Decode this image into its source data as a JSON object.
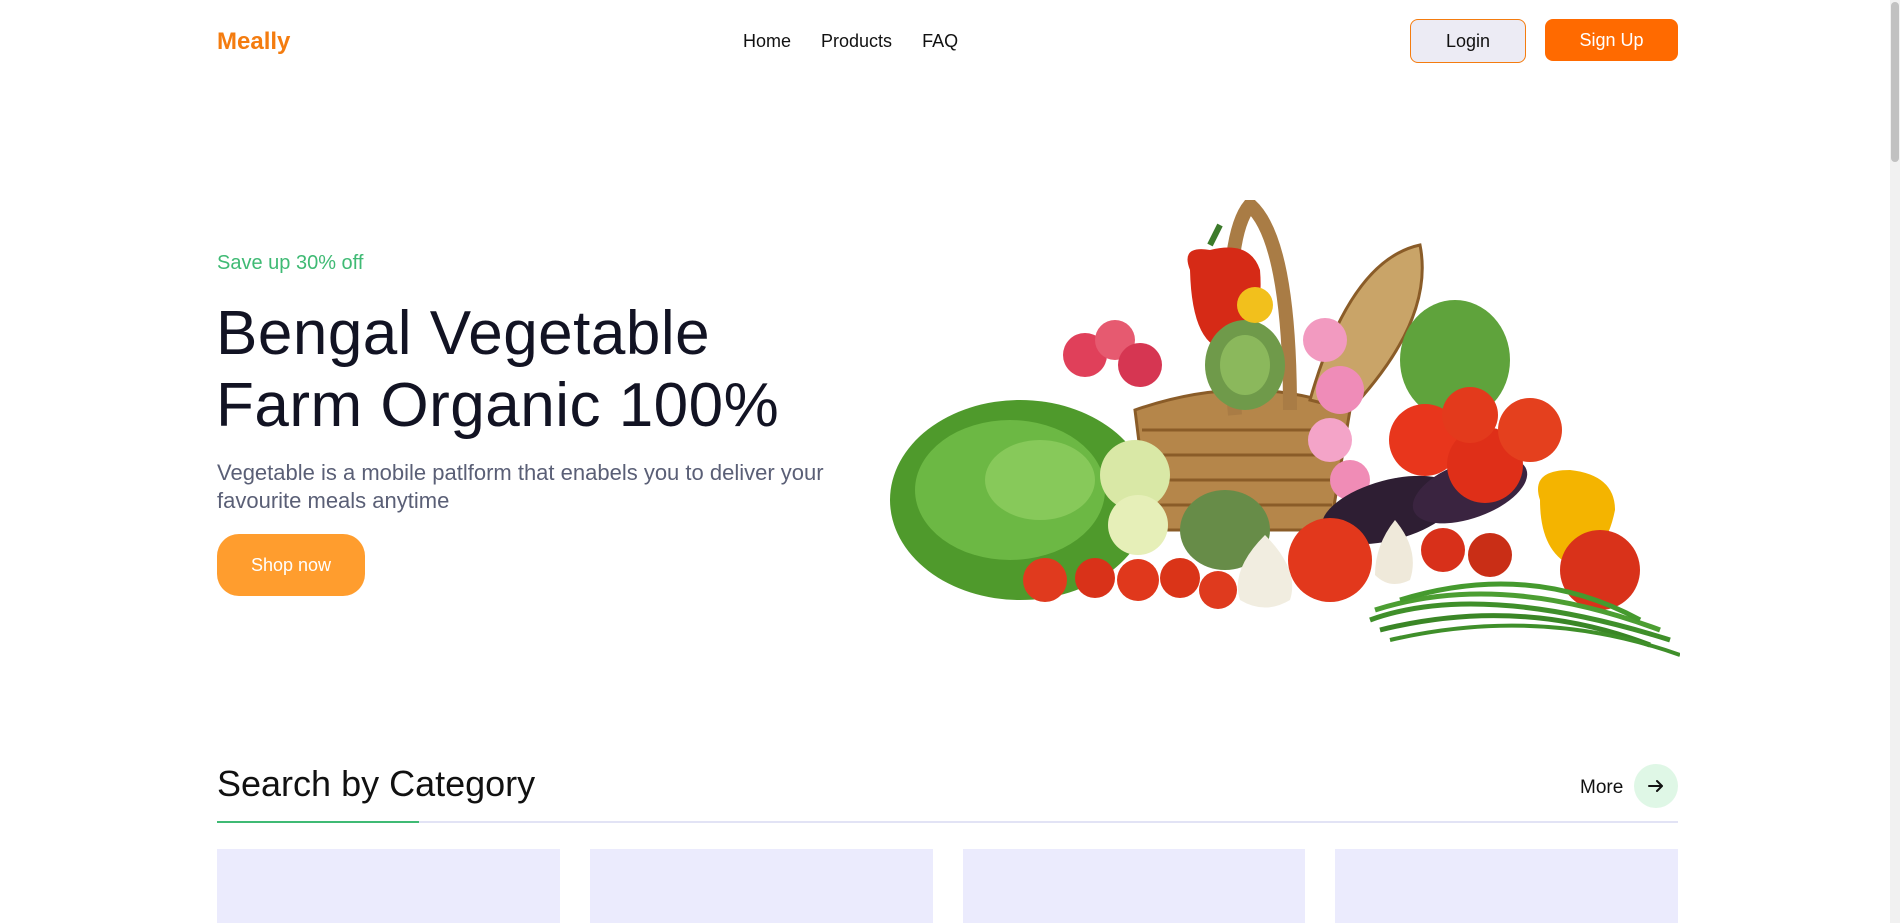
{
  "brand": {
    "logo": "Meally",
    "accent": "#f47c0f"
  },
  "nav": {
    "items": [
      "Home",
      "Products",
      "FAQ"
    ]
  },
  "auth": {
    "login": "Login",
    "signup": "Sign Up"
  },
  "hero": {
    "tag": "Save up 30% off",
    "title_line1": "Bengal Vegetable",
    "title_line2": "Farm Organic 100%",
    "description": "Vegetable is a mobile patlform that enabels you to deliver your favourite meals anytime",
    "cta": "Shop now",
    "image_icon": "vegetable-basket-illustration"
  },
  "category": {
    "title": "Search by Category",
    "more": "More",
    "more_icon": "arrow-right-icon",
    "cards": 4
  }
}
